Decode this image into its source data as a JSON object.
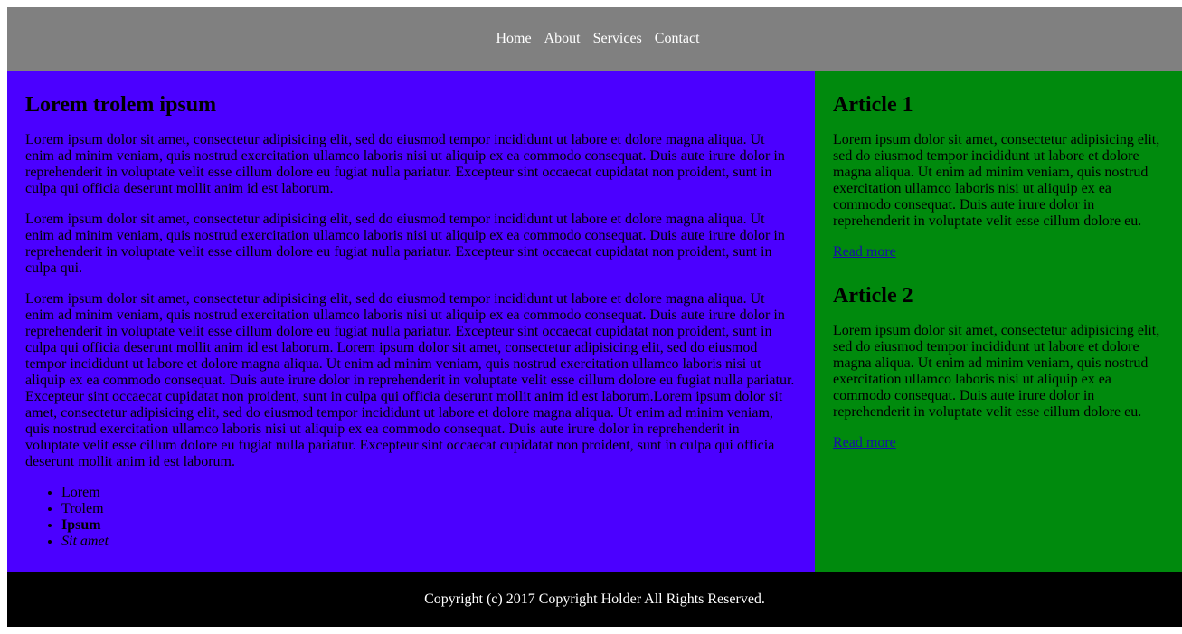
{
  "nav": {
    "items": [
      "Home",
      "About",
      "Services",
      "Contact"
    ]
  },
  "main": {
    "title": "Lorem trolem ipsum",
    "paragraphs": [
      "Lorem ipsum dolor sit amet, consectetur adipisicing elit, sed do eiusmod tempor incididunt ut labore et dolore magna aliqua. Ut enim ad minim veniam, quis nostrud exercitation ullamco laboris nisi ut aliquip ex ea commodo consequat. Duis aute irure dolor in reprehenderit in voluptate velit esse cillum dolore eu fugiat nulla pariatur. Excepteur sint occaecat cupidatat non proident, sunt in culpa qui officia deserunt mollit anim id est laborum.",
      "Lorem ipsum dolor sit amet, consectetur adipisicing elit, sed do eiusmod tempor incididunt ut labore et dolore magna aliqua. Ut enim ad minim veniam, quis nostrud exercitation ullamco laboris nisi ut aliquip ex ea commodo consequat. Duis aute irure dolor in reprehenderit in voluptate velit esse cillum dolore eu fugiat nulla pariatur. Excepteur sint occaecat cupidatat non proident, sunt in culpa qui.",
      "Lorem ipsum dolor sit amet, consectetur adipisicing elit, sed do eiusmod tempor incididunt ut labore et dolore magna aliqua. Ut enim ad minim veniam, quis nostrud exercitation ullamco laboris nisi ut aliquip ex ea commodo consequat. Duis aute irure dolor in reprehenderit in voluptate velit esse cillum dolore eu fugiat nulla pariatur. Excepteur sint occaecat cupidatat non proident, sunt in culpa qui officia deserunt mollit anim id est laborum. Lorem ipsum dolor sit amet, consectetur adipisicing elit, sed do eiusmod tempor incididunt ut labore et dolore magna aliqua. Ut enim ad minim veniam, quis nostrud exercitation ullamco laboris nisi ut aliquip ex ea commodo consequat. Duis aute irure dolor in reprehenderit in voluptate velit esse cillum dolore eu fugiat nulla pariatur. Excepteur sint occaecat cupidatat non proident, sunt in culpa qui officia deserunt mollit anim id est laborum.Lorem ipsum dolor sit amet, consectetur adipisicing elit, sed do eiusmod tempor incididunt ut labore et dolore magna aliqua. Ut enim ad minim veniam, quis nostrud exercitation ullamco laboris nisi ut aliquip ex ea commodo consequat. Duis aute irure dolor in reprehenderit in voluptate velit esse cillum dolore eu fugiat nulla pariatur. Excepteur sint occaecat cupidatat non proident, sunt in culpa qui officia deserunt mollit anim id est laborum."
    ],
    "list": [
      "Lorem",
      "Trolem",
      "Ipsum",
      "Sit amet"
    ]
  },
  "sidebar": {
    "articles": [
      {
        "title": "Article 1",
        "text": "Lorem ipsum dolor sit amet, consectetur adipisicing elit, sed do eiusmod tempor incididunt ut labore et dolore magna aliqua. Ut enim ad minim veniam, quis nostrud exercitation ullamco laboris nisi ut aliquip ex ea commodo consequat. Duis aute irure dolor in reprehenderit in voluptate velit esse cillum dolore eu.",
        "link": "Read more"
      },
      {
        "title": "Article 2",
        "text": "Lorem ipsum dolor sit amet, consectetur adipisicing elit, sed do eiusmod tempor incididunt ut labore et dolore magna aliqua. Ut enim ad minim veniam, quis nostrud exercitation ullamco laboris nisi ut aliquip ex ea commodo consequat. Duis aute irure dolor in reprehenderit in voluptate velit esse cillum dolore eu.",
        "link": "Read more"
      }
    ]
  },
  "footer": {
    "text": "Copyright (c) 2017 Copyright Holder All Rights Reserved."
  },
  "colors": {
    "header_bg": "#808080",
    "main_bg": "#4b00ff",
    "sidebar_bg": "#008a0d",
    "footer_bg": "#000000"
  }
}
